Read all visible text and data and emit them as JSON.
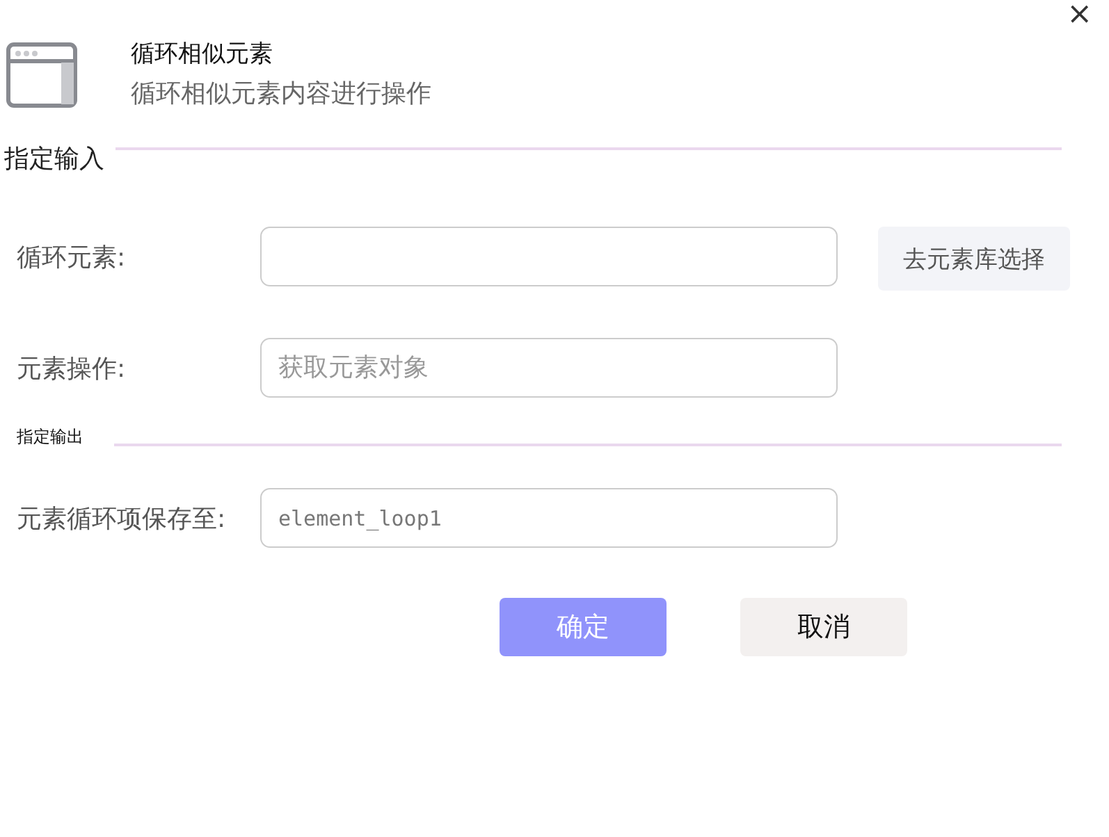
{
  "close": "×",
  "header": {
    "title": "循环相似元素",
    "subtitle": "循环相似元素内容进行操作"
  },
  "sections": [
    {
      "title": "指定输入",
      "kind": "large",
      "fields": [
        {
          "label": "循环元素:",
          "kind": "text",
          "button": "去元素库选择"
        },
        {
          "label": "元素操作:",
          "kind": "text",
          "placeholder": "获取元素对象"
        }
      ]
    },
    {
      "title": "指定输出",
      "kind": "small",
      "fields": [
        {
          "label": "元素循环项保存至:",
          "kind": "code",
          "value": "element_loop1"
        }
      ]
    }
  ],
  "buttons": [
    {
      "label": "确定",
      "kind": "primary"
    },
    {
      "label": "取消",
      "kind": "secondary"
    }
  ]
}
